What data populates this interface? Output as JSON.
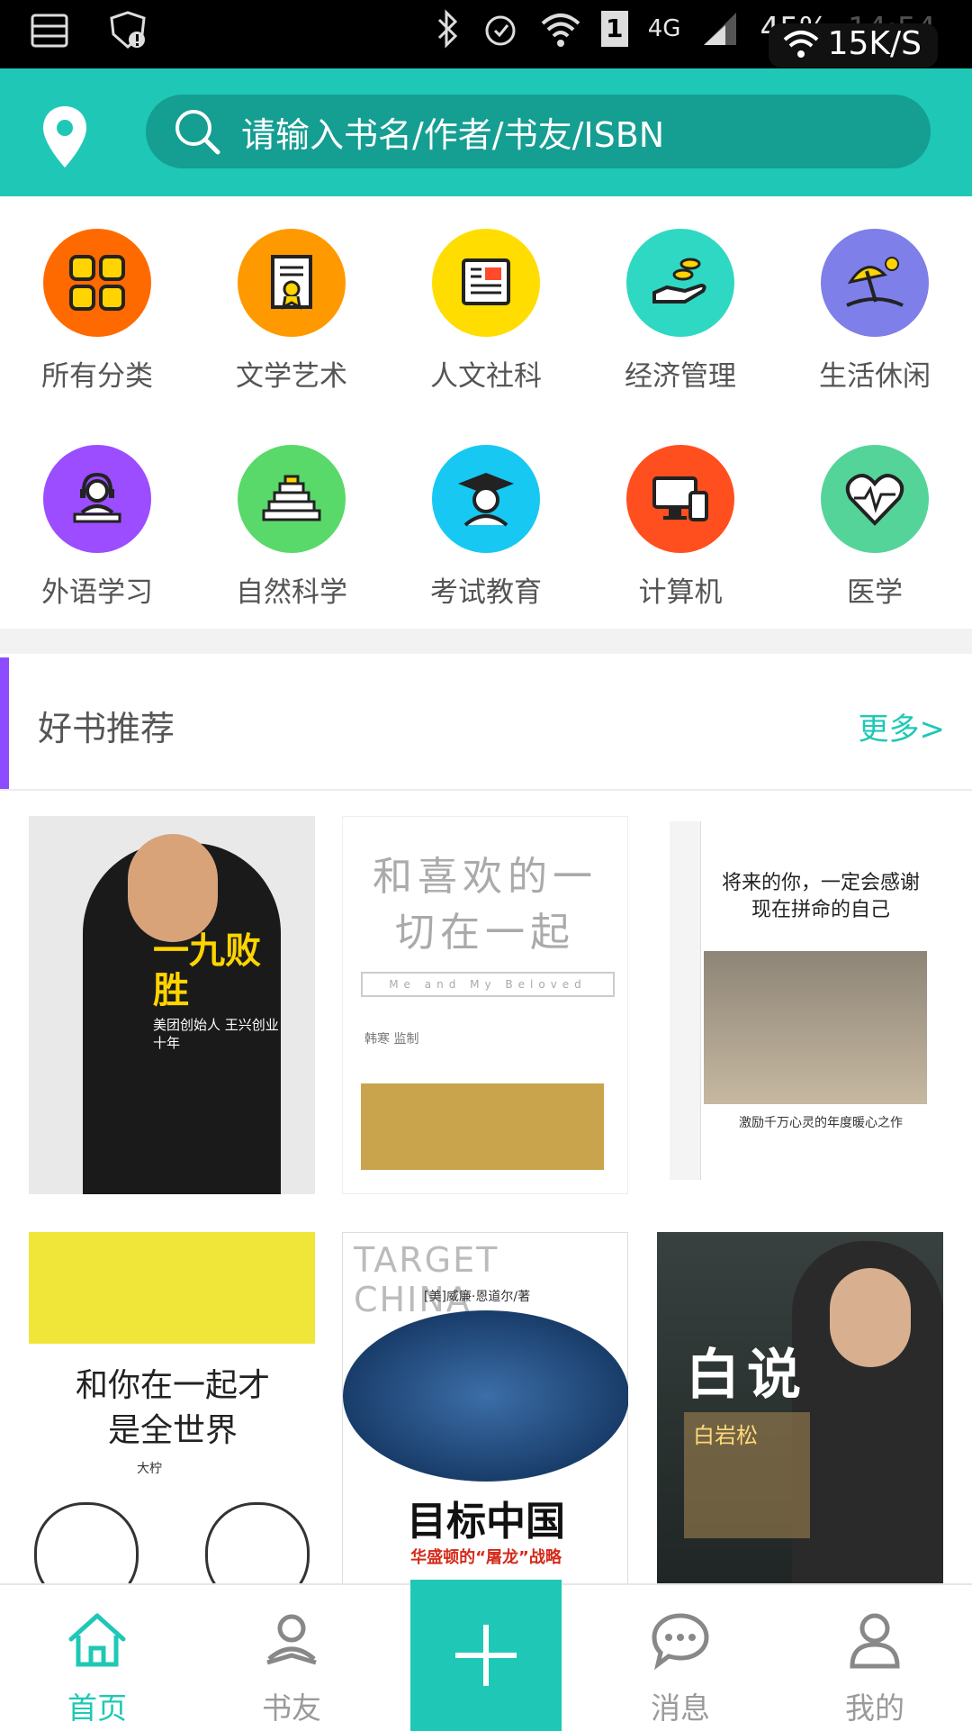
{
  "status_bar": {
    "battery": "45%",
    "signal": "4G",
    "sim": "1",
    "net_speed": "15K/S",
    "time": "14:54"
  },
  "header": {
    "search_placeholder": "请输入书名/作者/书友/ISBN",
    "icons": {
      "location": "location-pin-icon",
      "search": "search-icon"
    }
  },
  "categories": [
    {
      "label": "所有分类",
      "color": "#ff6a00",
      "icon": "grid-icon"
    },
    {
      "label": "文学艺术",
      "color": "#ff9900",
      "icon": "certificate-icon"
    },
    {
      "label": "人文社科",
      "color": "#ffdd00",
      "icon": "newspaper-icon"
    },
    {
      "label": "经济管理",
      "color": "#2fd8c2",
      "icon": "coins-hand-icon"
    },
    {
      "label": "生活休闲",
      "color": "#7e7fe8",
      "icon": "beach-umbrella-icon"
    },
    {
      "label": "外语学习",
      "color": "#9b4dff",
      "icon": "headphones-student-icon"
    },
    {
      "label": "自然科学",
      "color": "#59d96a",
      "icon": "pyramid-icon"
    },
    {
      "label": "考试教育",
      "color": "#16c8f2",
      "icon": "graduate-icon"
    },
    {
      "label": "计算机",
      "color": "#ff4f1f",
      "icon": "computer-icon"
    },
    {
      "label": "医学",
      "color": "#55d49a",
      "icon": "heart-pulse-icon"
    }
  ],
  "recommend": {
    "title": "好书推荐",
    "more": "更多>"
  },
  "books": [
    {
      "title": "一九败胜",
      "subtitle": "美团创始人 王兴创业十年"
    },
    {
      "title": "和喜欢的一切在一起",
      "subtitle": "Me and My Beloved",
      "extra": "韩寒 监制"
    },
    {
      "title": "将来的你，一定会感谢现在拼命的自己",
      "subtitle": "激励千万心灵的年度暖心之作"
    },
    {
      "title": "和你在一起才是全世界",
      "subtitle": "大柠"
    },
    {
      "title": "目标中国",
      "subtitle": "华盛顿的“屠龙”战略",
      "extra": "TARGET CHINA",
      "author": "[美]威廉·恩道尔/著"
    },
    {
      "title": "白说",
      "subtitle": "白岩松"
    }
  ],
  "bottom_nav": [
    {
      "label": "首页",
      "icon": "home-icon",
      "active": true
    },
    {
      "label": "书友",
      "icon": "reader-icon",
      "active": false
    },
    {
      "label": "",
      "icon": "plus-icon",
      "active": false
    },
    {
      "label": "消息",
      "icon": "chat-bubble-icon",
      "active": false
    },
    {
      "label": "我的",
      "icon": "user-icon",
      "active": false
    }
  ],
  "colors": {
    "accent": "#1fc8b6",
    "search_bg": "#159e92",
    "recommend_bar": "#8b4dff"
  }
}
